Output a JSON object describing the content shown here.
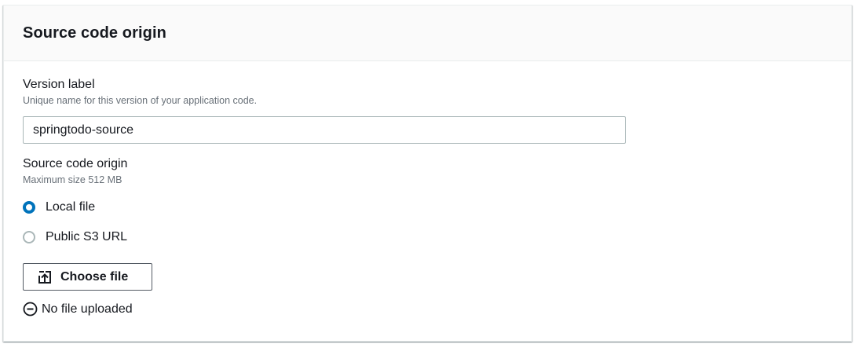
{
  "panel": {
    "title": "Source code origin"
  },
  "version_label": {
    "label": "Version label",
    "description": "Unique name for this version of your application code.",
    "value": "springtodo-source"
  },
  "source_origin": {
    "label": "Source code origin",
    "description": "Maximum size 512 MB",
    "options": [
      {
        "label": "Local file",
        "selected": true
      },
      {
        "label": "Public S3 URL",
        "selected": false
      }
    ]
  },
  "upload": {
    "button_label": "Choose file",
    "button_icon": "upload-icon",
    "status_icon": "minus-circle-icon",
    "status_text": "No file uploaded"
  },
  "colors": {
    "accent": "#0073bb",
    "border": "#aab7b8",
    "text": "#16191f",
    "muted": "#687078"
  }
}
